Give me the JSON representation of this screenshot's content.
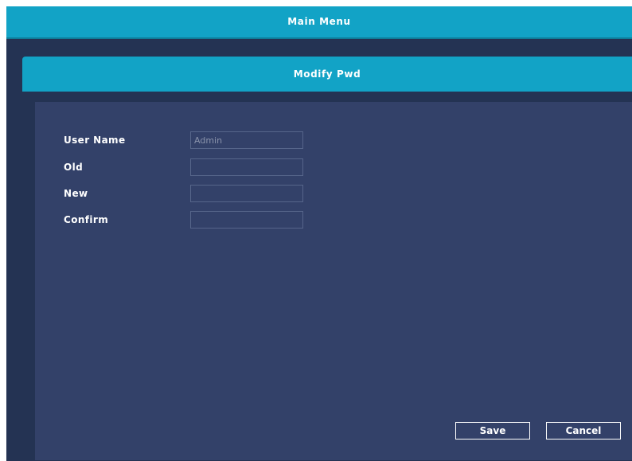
{
  "header": {
    "title": "Main Menu"
  },
  "dialog": {
    "title": "Modify Pwd",
    "fields": [
      {
        "label": "User Name",
        "value": "Admin",
        "placeholder": ""
      },
      {
        "label": "Old",
        "value": "",
        "placeholder": ""
      },
      {
        "label": "New",
        "value": "",
        "placeholder": ""
      },
      {
        "label": "Confirm",
        "value": "",
        "placeholder": ""
      }
    ],
    "buttons": {
      "save": "Save",
      "cancel": "Cancel"
    }
  },
  "colors": {
    "header": "#12a3c6",
    "background": "#2d3c5c",
    "panel": "#334169"
  }
}
